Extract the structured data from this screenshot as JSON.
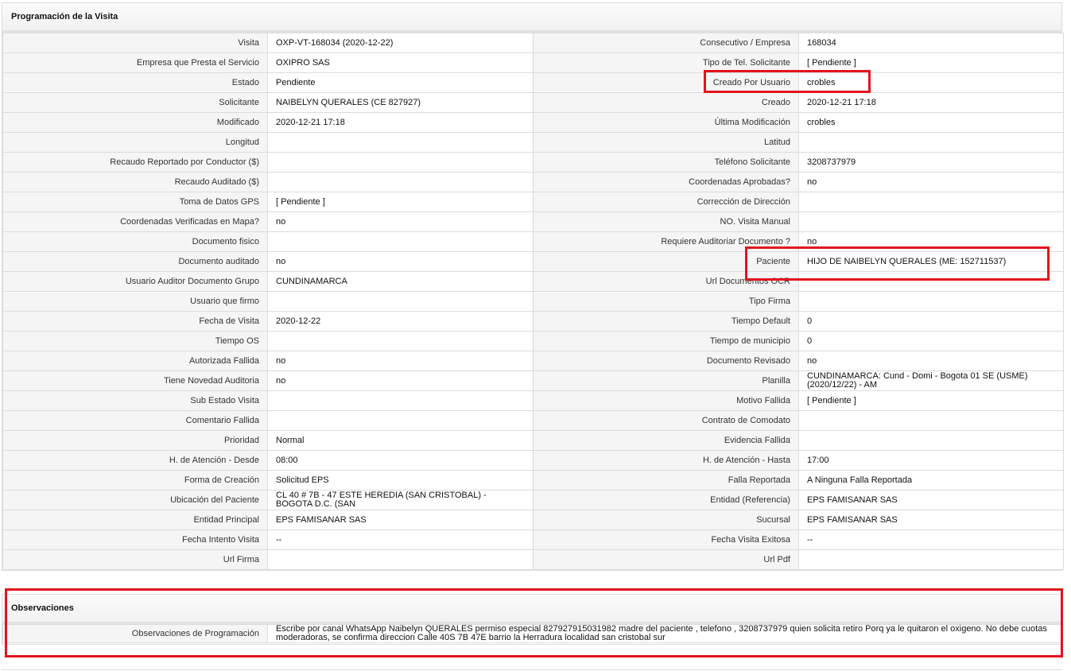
{
  "section1": {
    "title": "Programación de la Visita",
    "rows": [
      {
        "l1": "Visita",
        "v1": "OXP-VT-168034 (2020-12-22)",
        "l2": "Consecutivo / Empresa",
        "v2": "168034"
      },
      {
        "l1": "Empresa que Presta el Servicio",
        "v1": "OXIPRO SAS",
        "l2": "Tipo de Tel. Solicitante",
        "v2": "[ Pendiente ]"
      },
      {
        "l1": "Estado",
        "v1": "Pendiente",
        "l2": "Creado Por Usuario",
        "v2": "crobles"
      },
      {
        "l1": "Solicitante",
        "v1": "NAIBELYN QUERALES (CE 827927)",
        "l2": "Creado",
        "v2": "2020-12-21 17:18"
      },
      {
        "l1": "Modificado",
        "v1": "2020-12-21 17:18",
        "l2": "Última Modificación",
        "v2": " crobles"
      },
      {
        "l1": "Longitud",
        "v1": "",
        "l2": "Latitud",
        "v2": ""
      },
      {
        "l1": "Recaudo Reportado por Conductor ($)",
        "v1": "",
        "l2": "Teléfono Solicitante",
        "v2": "3208737979"
      },
      {
        "l1": "Recaudo Auditado ($)",
        "v1": "",
        "l2": "Coordenadas Aprobadas?",
        "v2": " no"
      },
      {
        "l1": "Toma de Datos GPS",
        "v1": "[ Pendiente ]",
        "l2": "Corrección de Dirección",
        "v2": ""
      },
      {
        "l1": "Coordenadas Verificadas en Mapa?",
        "v1": " no",
        "l2": "NO. Visita Manual",
        "v2": ""
      },
      {
        "l1": "Documento fisico",
        "v1": "",
        "l2": "Requiere Auditoriar Documento ?",
        "v2": " no"
      },
      {
        "l1": "Documento auditado",
        "v1": " no",
        "l2": "Paciente",
        "v2": "HIJO DE NAIBELYN QUERALES (ME: 152711537)"
      },
      {
        "l1": "Usuario Auditor Documento Grupo",
        "v1": "CUNDINAMARCA",
        "l2": "Url Documentos OCR",
        "v2": ""
      },
      {
        "l1": "Usuario que firmo",
        "v1": "",
        "l2": "Tipo Firma",
        "v2": ""
      },
      {
        "l1": "Fecha de Visita",
        "v1": " 2020-12-22",
        "l2": "Tiempo Default",
        "v2": "0"
      },
      {
        "l1": "Tiempo OS",
        "v1": "",
        "l2": "Tiempo de municipio",
        "v2": "0"
      },
      {
        "l1": "Autorizada Fallida",
        "v1": " no",
        "l2": "Documento Revisado",
        "v2": " no"
      },
      {
        "l1": "Tiene Novedad Auditoria",
        "v1": " no",
        "l2": "Planilla",
        "v2": "CUNDINAMARCA: Cund - Domi - Bogota 01 SE (USME) (2020/12/22) - AM"
      },
      {
        "l1": "Sub Estado Visita",
        "v1": "",
        "l2": "Motivo Fallida",
        "v2": "[ Pendiente ]"
      },
      {
        "l1": "Comentario Fallida",
        "v1": "",
        "l2": "Contrato de Comodato",
        "v2": ""
      },
      {
        "l1": "Prioridad",
        "v1": "Normal",
        "l2": "Evidencia Fallida",
        "v2": ""
      },
      {
        "l1": "H. de Atención - Desde",
        "v1": "08:00",
        "l2": "H. de Atención - Hasta",
        "v2": "17:00"
      },
      {
        "l1": "Forma de Creación",
        "v1": "Solicitud EPS",
        "l2": "Falla Reportada",
        "v2": "A Ninguna Falla Reportada"
      },
      {
        "l1": "Ubicación del Paciente",
        "v1": "CL 40 # 7B - 47 ESTE HEREDIA (SAN CRISTOBAL) - BOGOTA D.C. (SAN",
        "l2": "Entidad (Referencia)",
        "v2": "EPS FAMISANAR SAS"
      },
      {
        "l1": "Entidad Principal",
        "v1": "EPS FAMISANAR SAS",
        "l2": "Sucursal",
        "v2": "EPS FAMISANAR SAS"
      },
      {
        "l1": "Fecha Intento Visita",
        "v1": " --",
        "l2": "Fecha Visita Exitosa",
        "v2": " --"
      },
      {
        "l1": "Url Firma",
        "v1": "",
        "l2": "Url Pdf",
        "v2": ""
      }
    ]
  },
  "section2": {
    "title": "Observaciones",
    "label": "Observaciones de Programación",
    "value": "   Escribe por canal WhatsApp Naibelyn QUERALES permiso especial 827927915031982 madre del paciente , telefono , 3208737979 quien solicita retiro Porq ya le quitaron el oxigeno. No debe cuotas moderadoras, se confirma direccion Calle 40S 7B 47E barrio la Herradura localidad san cristobal sur"
  },
  "highlight_color": "#e3141e"
}
